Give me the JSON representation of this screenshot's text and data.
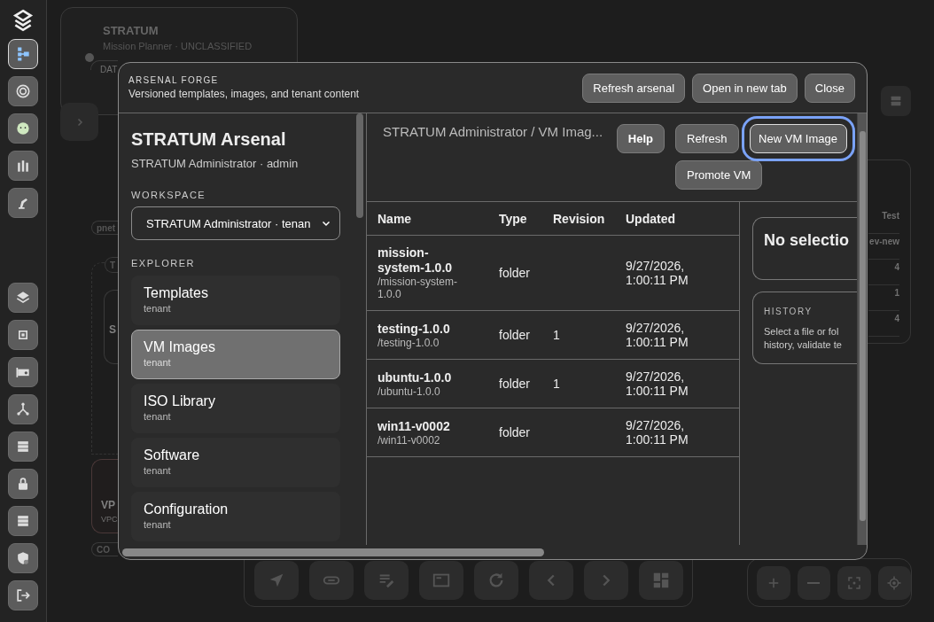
{
  "rail": {
    "top": [
      {
        "selected": true
      },
      {
        "selected": false
      },
      {
        "selected": false
      },
      {
        "selected": false
      },
      {
        "selected": false
      }
    ],
    "bottom": [
      {
        "selected": false
      },
      {
        "selected": false
      },
      {
        "selected": false
      },
      {
        "selected": false
      },
      {
        "selected": false
      },
      {
        "selected": false
      },
      {
        "selected": false
      },
      {
        "selected": false
      },
      {
        "selected": false
      }
    ]
  },
  "canvas": {
    "mission_card": {
      "title": "STRATUM",
      "subtitle": "Mission Planner · UNCLASSIFIED",
      "field": "DAT"
    },
    "labels": [
      {
        "kind": "pill",
        "text": "pnet"
      },
      {
        "kind": "pill",
        "text": "T"
      },
      {
        "kind": "node",
        "text": "S"
      },
      {
        "kind": "vpc",
        "text": "VP",
        "subtext": "VPC"
      },
      {
        "kind": "pill",
        "text": "CO"
      }
    ],
    "side_values": [
      "Test",
      "ev-new",
      "4",
      "1",
      "4"
    ]
  },
  "modal": {
    "eyebrow": "ARSENAL FORGE",
    "subtitle": "Versioned templates, images, and tenant content",
    "header_buttons": [
      "Refresh arsenal",
      "Open in new tab",
      "Close"
    ],
    "title": "STRATUM Arsenal",
    "user": "STRATUM Administrator · admin",
    "workspace_label": "WORKSPACE",
    "workspace_value": "STRATUM Administrator · tenan",
    "explorer_label": "EXPLORER",
    "explorer": [
      {
        "label": "Templates",
        "scope": "tenant",
        "selected": false
      },
      {
        "label": "VM Images",
        "scope": "tenant",
        "selected": true
      },
      {
        "label": "ISO Library",
        "scope": "tenant",
        "selected": false
      },
      {
        "label": "Software",
        "scope": "tenant",
        "selected": false
      },
      {
        "label": "Configuration",
        "scope": "tenant",
        "selected": false
      }
    ],
    "breadcrumb": "STRATUM Administrator / VM Imag...",
    "actions": [
      {
        "label": "Help",
        "kind": "help",
        "focused": false
      },
      {
        "label": "Refresh",
        "kind": "plain",
        "focused": false
      },
      {
        "label": "New VM Image",
        "kind": "plain",
        "focused": true
      },
      {
        "label": "Promote VM",
        "kind": "plain",
        "focused": false
      }
    ],
    "table": {
      "columns": [
        "Name",
        "Type",
        "Revision",
        "Updated"
      ],
      "rows": [
        {
          "name": "mission-system-1.0.0",
          "path": "/mission-system-1.0.0",
          "type": "folder",
          "updated": "9/27/2026, 1:00:11 PM"
        },
        {
          "name": "testing-1.0.0",
          "path": "/testing-1.0.0",
          "type": "folder",
          "revision": "1",
          "updated": "9/27/2026, 1:00:11 PM"
        },
        {
          "name": "ubuntu-1.0.0",
          "path": "/ubuntu-1.0.0",
          "type": "folder",
          "revision": "1",
          "updated": "9/27/2026, 1:00:11 PM"
        },
        {
          "name": "win11-v0002",
          "path": "/win11-v0002",
          "type": "folder",
          "updated": "9/27/2026, 1:00:11 PM"
        }
      ]
    },
    "detail": {
      "title": "No selectio",
      "history_label": "HISTORY",
      "history_lines": [
        "Select a file or fol",
        "history, validate te"
      ]
    }
  }
}
